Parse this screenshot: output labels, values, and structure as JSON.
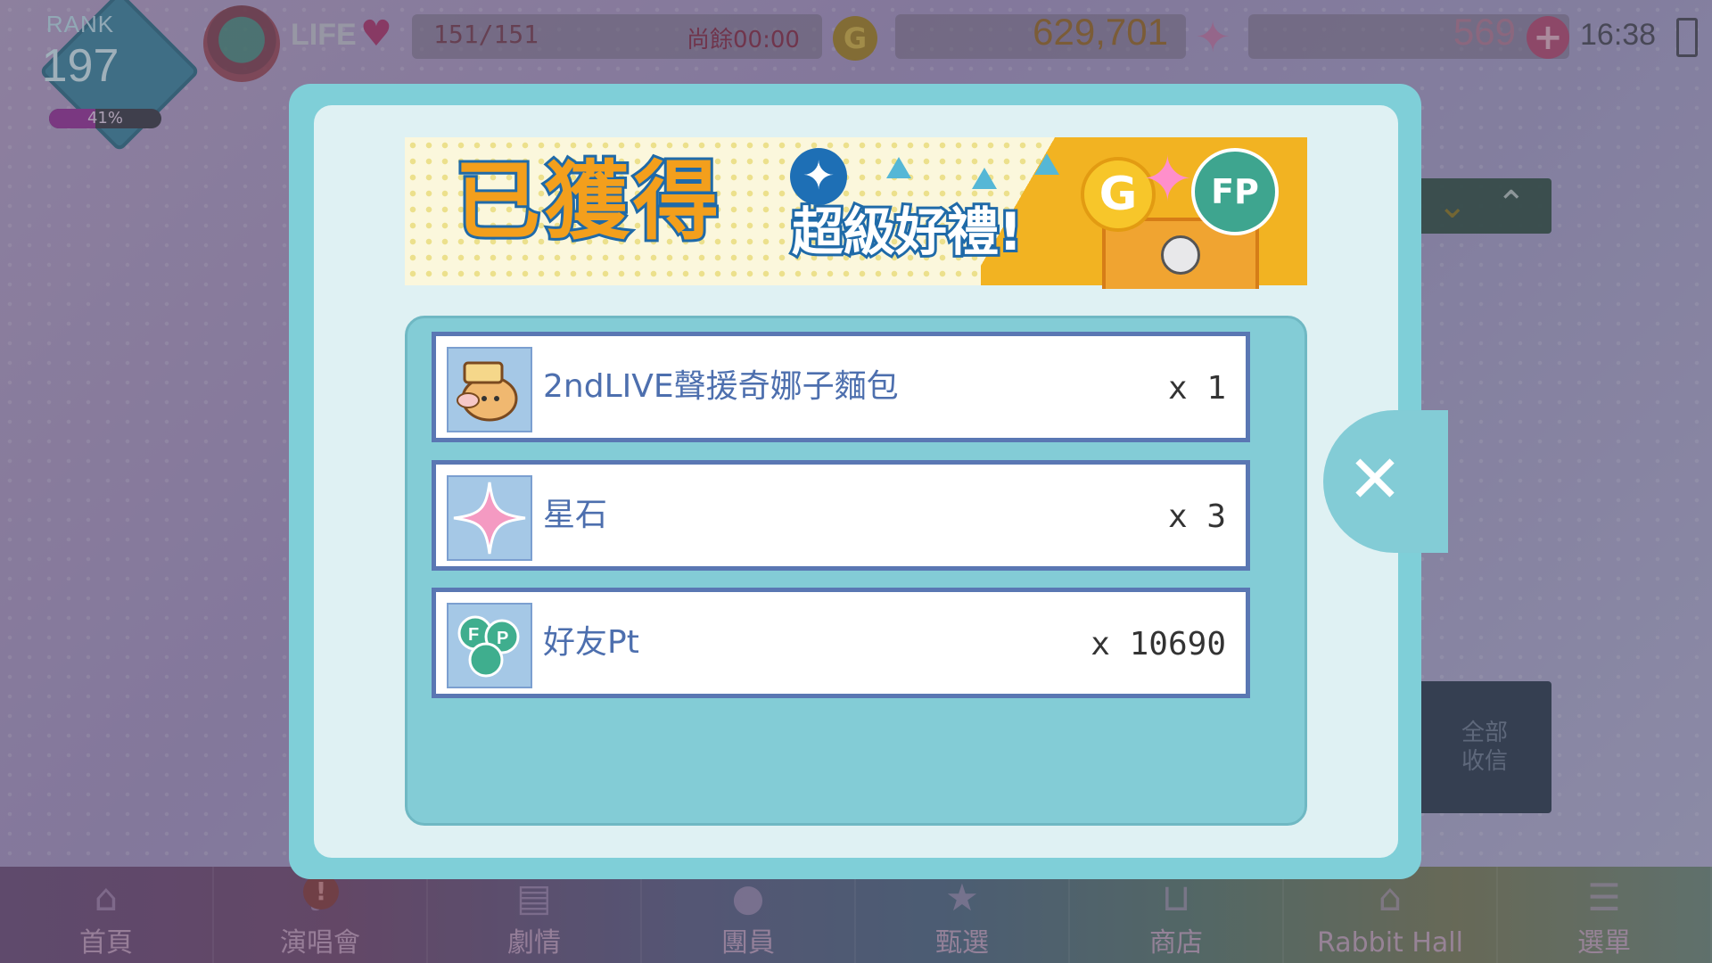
{
  "hud": {
    "rank_label": "RANK",
    "rank_value": "197",
    "rank_progress_text": "41%",
    "rank_progress_fraction": 0.41,
    "life_label": "LIFE",
    "life_count": "151/151",
    "life_timer": "尚餘00:00",
    "coin_icon": "G",
    "gold_value": "629,701",
    "star_value": "569",
    "time": "16:38"
  },
  "modal": {
    "banner_title": "已獲得",
    "banner_subtitle": "超級好禮!",
    "banner_coin": "G",
    "banner_fp": "FP",
    "rewards": [
      {
        "name": "2ndLIVE聲援奇娜子麵包",
        "qty": "x 1",
        "icon": "bread-character-icon"
      },
      {
        "name": "星石",
        "qty": "x 3",
        "icon": "star-stone-icon"
      },
      {
        "name": "好友Pt",
        "qty": "x 10690",
        "icon": "friend-point-clover-icon"
      }
    ]
  },
  "side": {
    "receive_all": "全部\n收信"
  },
  "nav": {
    "items": [
      {
        "label": "首頁",
        "icon": "home-icon"
      },
      {
        "label": "演唱會",
        "icon": "music-note-icon"
      },
      {
        "label": "劇情",
        "icon": "book-icon"
      },
      {
        "label": "團員",
        "icon": "member-icon"
      },
      {
        "label": "甄選",
        "icon": "audition-icon"
      },
      {
        "label": "商店",
        "icon": "shop-basket-icon"
      },
      {
        "label": "Rabbit Hall",
        "icon": "hall-icon"
      },
      {
        "label": "選單",
        "icon": "menu-list-icon"
      }
    ],
    "concert_badge": "!"
  },
  "colors": {
    "modal_frame": "#7fcfd8",
    "row_border": "#5a77b3",
    "name_text": "#4d6fae",
    "banner_orange": "#f39f1c",
    "banner_blue": "#1f6aa8"
  }
}
